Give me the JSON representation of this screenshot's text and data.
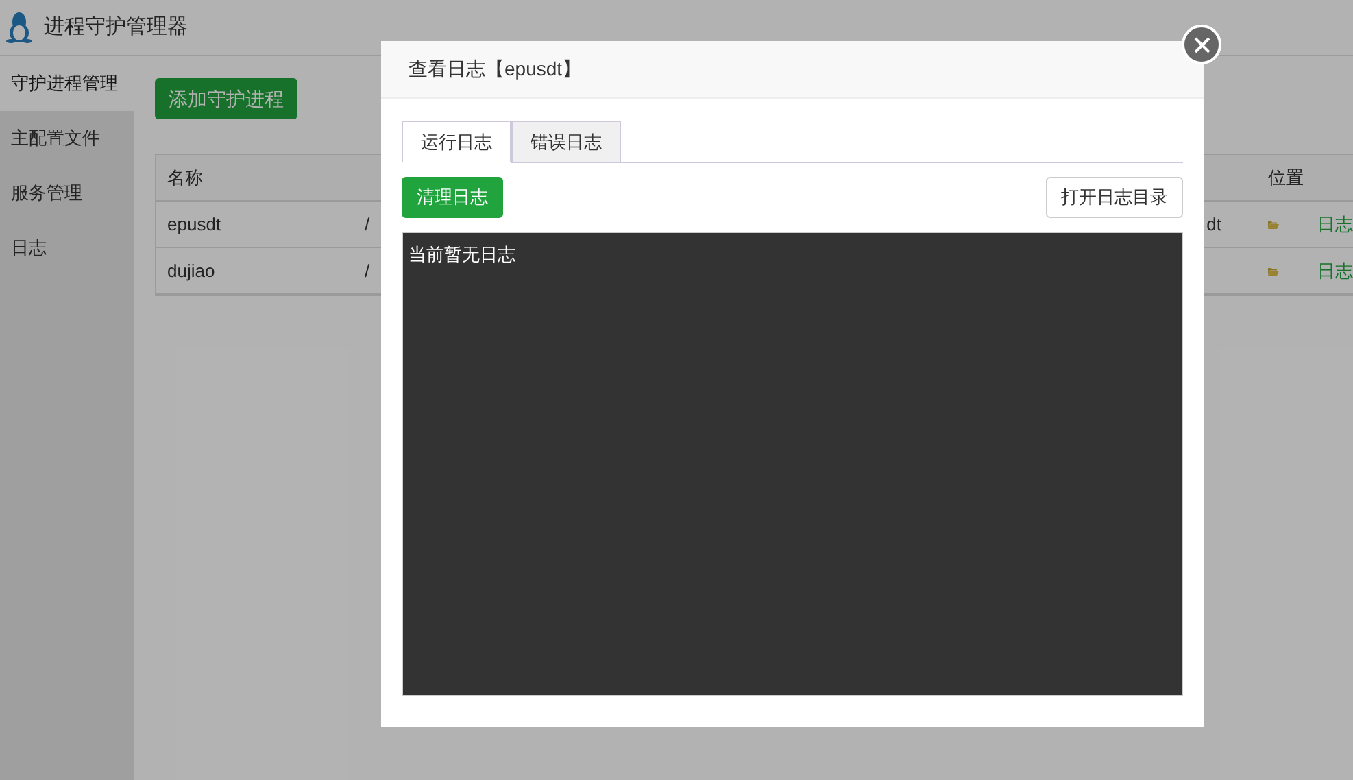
{
  "app": {
    "title": "进程守护管理器"
  },
  "sidebar": {
    "items": [
      {
        "label": "守护进程管理",
        "selected": true
      },
      {
        "label": "主配置文件",
        "selected": false
      },
      {
        "label": "服务管理",
        "selected": false
      },
      {
        "label": "日志",
        "selected": false
      }
    ]
  },
  "toolbar": {
    "add_button": "添加守护进程"
  },
  "table": {
    "columns": {
      "column_1": "名称",
      "location": "位置"
    },
    "rows": [
      {
        "name": "epusdt",
        "column_2": "/",
        "column_3": "dt",
        "log_link": "日志"
      },
      {
        "name": "dujiao",
        "column_2": "/",
        "log_link": "日志"
      }
    ]
  },
  "dialog": {
    "title": "查看日志【epusdt】",
    "tabs": [
      {
        "label": "运行日志",
        "selected": true
      },
      {
        "label": "错误日志",
        "selected": false
      }
    ],
    "clear_button": "清理日志",
    "open_dir_button": "打开日志目录",
    "log_text": "当前暂无日志"
  }
}
